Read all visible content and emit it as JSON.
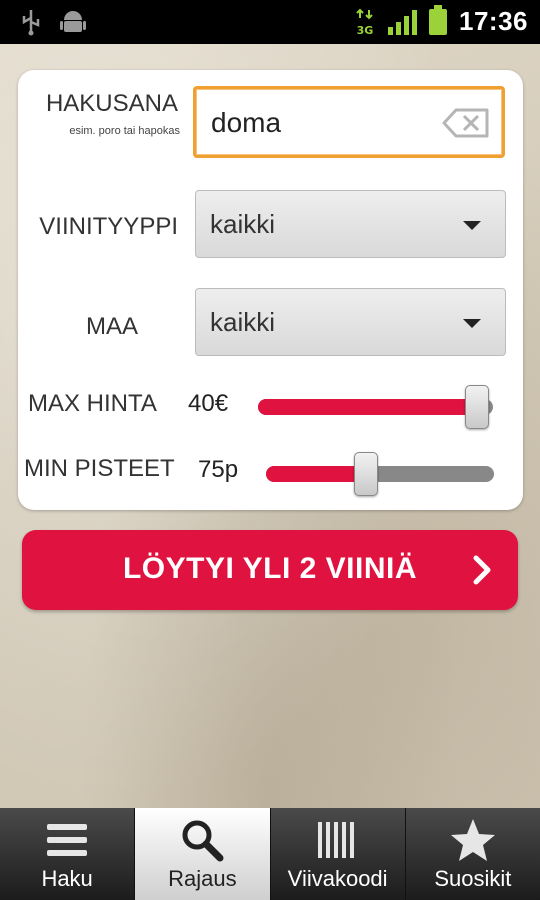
{
  "status_bar": {
    "time": "17:36",
    "network": "3G",
    "icons": [
      "usb-icon",
      "android-debug-icon",
      "data-3g-icon",
      "signal-icon",
      "battery-icon"
    ]
  },
  "filters": {
    "search": {
      "label": "HAKUSANA",
      "hint": "esim. poro tai hapokas",
      "value": "doma",
      "clear_icon": "backspace-clear-icon"
    },
    "wine_type": {
      "label": "VIINITYYPPI",
      "value": "kaikki"
    },
    "country": {
      "label": "MAA",
      "value": "kaikki"
    },
    "max_price": {
      "label": "MAX HINTA",
      "value_text": "40€",
      "level": 0.93
    },
    "min_points": {
      "label": "MIN PISTEET",
      "value_text": "75p",
      "level": 0.44
    }
  },
  "result_button": {
    "label": "LÖYTYI YLI 2 VIINIÄ",
    "icon": "chevron-right-icon"
  },
  "colors": {
    "accent": "#e0123f",
    "focus": "#f0a030",
    "signal": "#9bd23a"
  },
  "tabs": [
    {
      "label": "Haku",
      "icon": "list-icon",
      "active": false
    },
    {
      "label": "Rajaus",
      "icon": "search-icon",
      "active": true
    },
    {
      "label": "Viivakoodi",
      "icon": "barcode-icon",
      "active": false
    },
    {
      "label": "Suosikit",
      "icon": "star-icon",
      "active": false
    }
  ]
}
